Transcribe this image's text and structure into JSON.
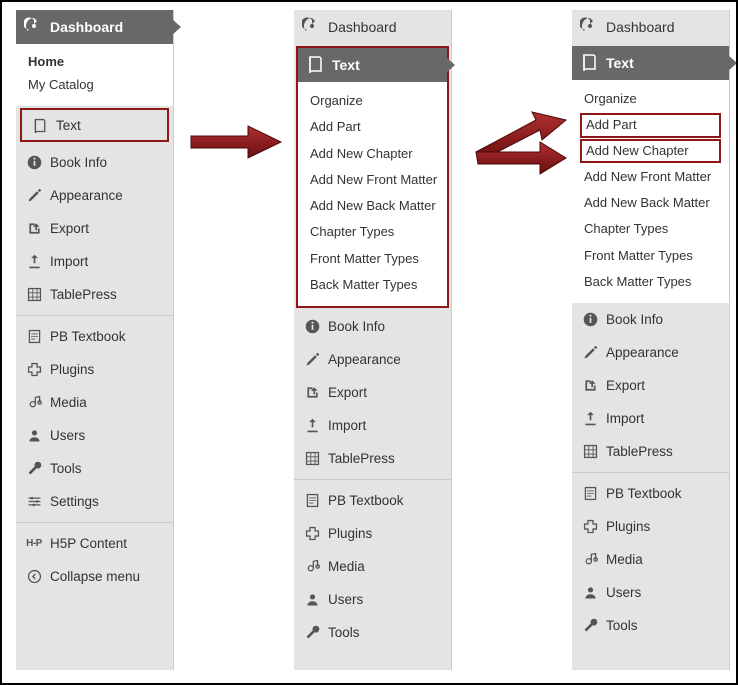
{
  "labels": {
    "dashboard": "Dashboard",
    "home": "Home",
    "mycatalog": "My Catalog",
    "text": "Text",
    "bookinfo": "Book Info",
    "appearance": "Appearance",
    "export": "Export",
    "import": "Import",
    "tablepress": "TablePress",
    "pbtextbook": "PB Textbook",
    "plugins": "Plugins",
    "media": "Media",
    "users": "Users",
    "tools": "Tools",
    "settings": "Settings",
    "h5p": "H5P Content",
    "collapse": "Collapse menu"
  },
  "submenu": {
    "organize": "Organize",
    "addpart": "Add Part",
    "addnewchapter": "Add New Chapter",
    "addnewfront": "Add New Front Matter",
    "addnewback": "Add New Back Matter",
    "chaptertypes": "Chapter Types",
    "frontmattertypes": "Front Matter Types",
    "backmattertypes": "Back Matter Types"
  }
}
